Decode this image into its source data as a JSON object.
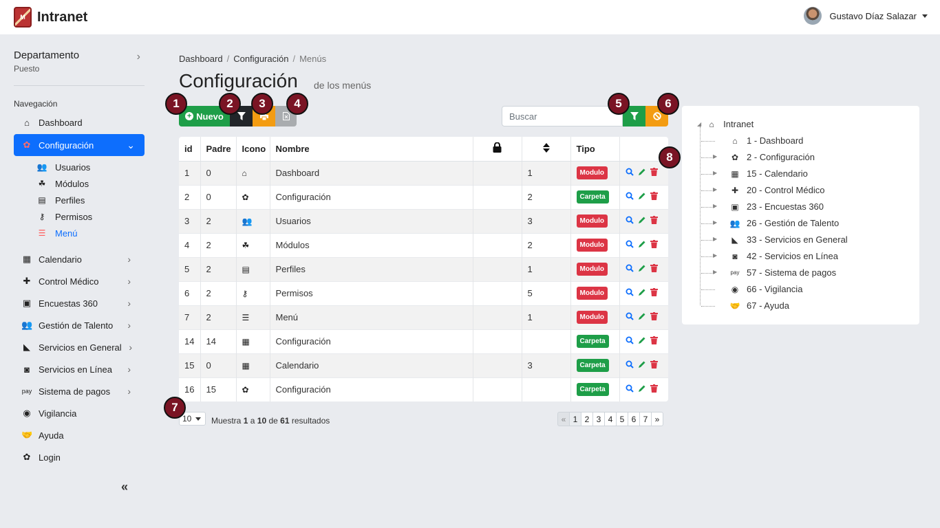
{
  "brand": {
    "title": "Intranet",
    "logo_text": "M"
  },
  "user": {
    "name": "Gustavo Díaz Salazar"
  },
  "sidebar": {
    "department": "Departamento",
    "position": "Puesto",
    "nav_label": "Navegación",
    "items": [
      {
        "label": "Dashboard",
        "icon": "home-icon"
      },
      {
        "label": "Configuración",
        "icon": "gear-icon"
      },
      {
        "label": "Calendario",
        "icon": "calendar-icon"
      },
      {
        "label": "Control Médico",
        "icon": "medkit-icon"
      },
      {
        "label": "Encuestas 360",
        "icon": "survey-icon"
      },
      {
        "label": "Gestión de Talento",
        "icon": "users-icon"
      },
      {
        "label": "Servicios en General",
        "icon": "satellite-icon"
      },
      {
        "label": "Servicios en Línea",
        "icon": "chat-icon"
      },
      {
        "label": "Sistema de pagos",
        "icon": "pay-icon"
      },
      {
        "label": "Vigilancia",
        "icon": "user-circle-icon"
      },
      {
        "label": "Ayuda",
        "icon": "handshake-icon"
      },
      {
        "label": "Login",
        "icon": "gear-icon"
      }
    ],
    "sub_items": [
      {
        "label": "Usuarios",
        "icon": "users-icon"
      },
      {
        "label": "Módulos",
        "icon": "cubes-icon"
      },
      {
        "label": "Perfiles",
        "icon": "id-card-icon"
      },
      {
        "label": "Permisos",
        "icon": "key-icon"
      },
      {
        "label": "Menú",
        "icon": "align-left-icon"
      }
    ],
    "collapse": "«"
  },
  "breadcrumb": [
    "Dashboard",
    "Configuración",
    "Menús"
  ],
  "page": {
    "title": "Configuración",
    "subtitle": "de los menús"
  },
  "toolbar": {
    "new_label": "Nuevo"
  },
  "search": {
    "placeholder": "Buscar"
  },
  "badges": [
    "1",
    "2",
    "3",
    "4",
    "5",
    "6",
    "7",
    "8"
  ],
  "table": {
    "headers": [
      "id",
      "Padre",
      "Icono",
      "Nombre",
      "",
      "",
      "Tipo",
      ""
    ],
    "rows": [
      {
        "id": "1",
        "padre": "0",
        "icon": "home-icon",
        "nombre": "Dashboard",
        "orden": "1",
        "tipo": "Modulo"
      },
      {
        "id": "2",
        "padre": "0",
        "icon": "gear-icon",
        "nombre": "Configuración",
        "orden": "2",
        "tipo": "Carpeta"
      },
      {
        "id": "3",
        "padre": "2",
        "icon": "users-icon",
        "nombre": "Usuarios",
        "orden": "3",
        "tipo": "Modulo"
      },
      {
        "id": "4",
        "padre": "2",
        "icon": "cubes-icon",
        "nombre": "Módulos",
        "orden": "2",
        "tipo": "Modulo"
      },
      {
        "id": "5",
        "padre": "2",
        "icon": "id-card-icon",
        "nombre": "Perfiles",
        "orden": "1",
        "tipo": "Modulo"
      },
      {
        "id": "6",
        "padre": "2",
        "icon": "key-icon",
        "nombre": "Permisos",
        "orden": "5",
        "tipo": "Modulo"
      },
      {
        "id": "7",
        "padre": "2",
        "icon": "align-left-icon",
        "nombre": "Menú",
        "orden": "1",
        "tipo": "Modulo"
      },
      {
        "id": "14",
        "padre": "14",
        "icon": "calendar-icon",
        "nombre": "Configuración",
        "orden": "",
        "tipo": "Carpeta"
      },
      {
        "id": "15",
        "padre": "0",
        "icon": "calendar-icon",
        "nombre": "Calendario",
        "orden": "3",
        "tipo": "Carpeta"
      },
      {
        "id": "16",
        "padre": "15",
        "icon": "gear-icon",
        "nombre": "Configuración",
        "orden": "",
        "tipo": "Carpeta"
      }
    ]
  },
  "pagination": {
    "page_size": "10",
    "results_prefix": "Muestra",
    "from": "1",
    "to_word": "a",
    "to": "10",
    "of_word": "de",
    "total": "61",
    "results_suffix": "resultados",
    "pages": [
      "«",
      "1",
      "2",
      "3",
      "4",
      "5",
      "6",
      "7",
      "»"
    ]
  },
  "tree": {
    "root": "Intranet",
    "nodes": [
      "1 - Dashboard",
      "2 - Configuración",
      "15 - Calendario",
      "20 - Control Médico",
      "23 - Encuestas 360",
      "26 - Gestión de Talento",
      "33 - Servicios en General",
      "42 - Servicios en Línea",
      "57 - Sistema de pagos",
      "66 - Vigilancia",
      "67 - Ayuda"
    ]
  }
}
